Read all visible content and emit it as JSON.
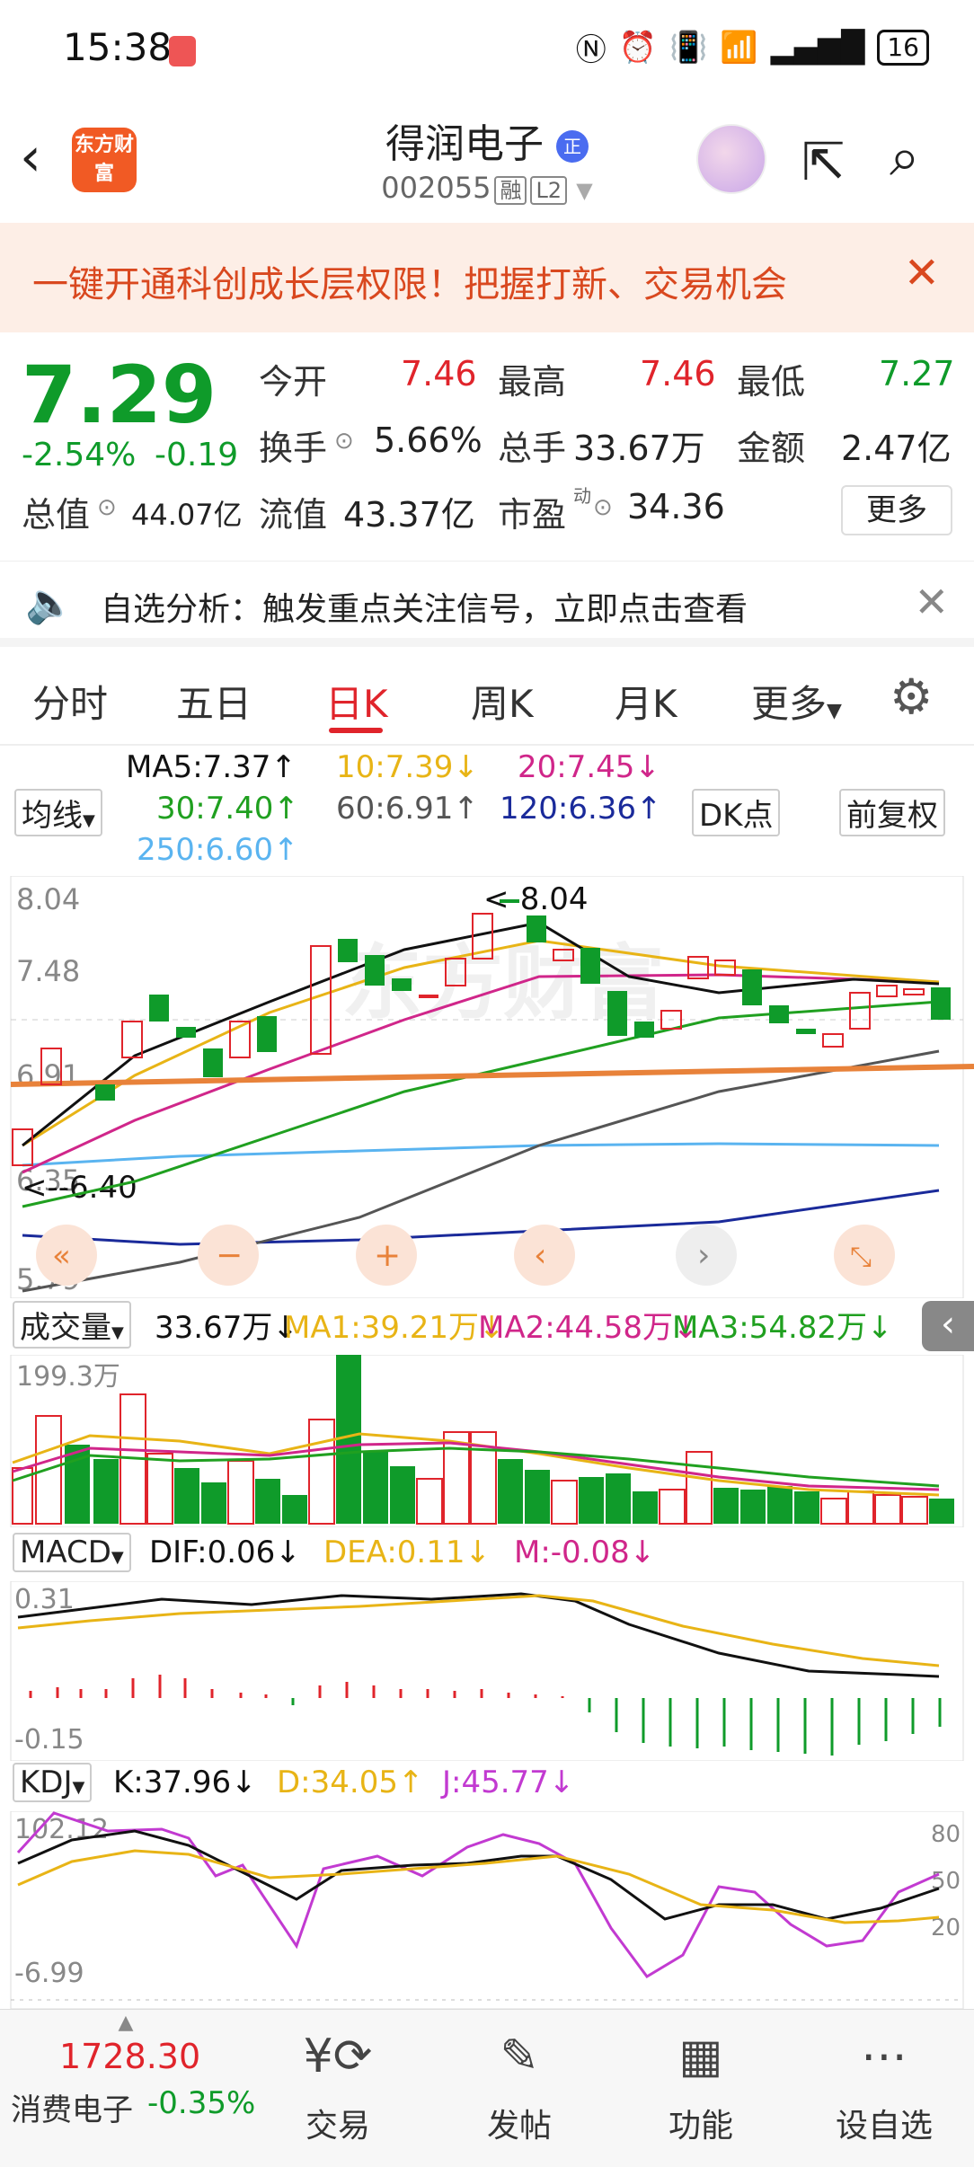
{
  "status": {
    "time": "15:38",
    "battery": "16",
    "signal": "5G"
  },
  "header": {
    "logo_text": "东方财富",
    "stock_name": "得润电子",
    "stock_tag": "正",
    "stock_code": "002055",
    "badge_margin": "融",
    "badge_level": "L2"
  },
  "banner": {
    "text": "一键开通科创成长层权限！把握打新、交易机会"
  },
  "quote": {
    "price": "7.29",
    "change_pct": "-2.54%",
    "change": "-0.19",
    "open_label": "今开",
    "open": "7.46",
    "high_label": "最高",
    "high": "7.46",
    "low_label": "最低",
    "low": "7.27",
    "turnover_label": "换手",
    "turnover": "5.66%",
    "volume_label": "总手",
    "volume": "33.67万",
    "amount_label": "金额",
    "amount": "2.47亿",
    "mktcap_label": "总值",
    "mktcap": "44.07亿",
    "float_label": "流值",
    "float": "43.37亿",
    "pe_label": "市盈",
    "pe_sup": "动",
    "pe": "34.36",
    "more": "更多"
  },
  "notice": {
    "text": "自选分析：触发重点关注信号，立即点击查看"
  },
  "tabs": [
    "分时",
    "五日",
    "日K",
    "周K",
    "月K",
    "更多"
  ],
  "ma_row": {
    "selector": "均线",
    "ma5": "MA5:7.37↑",
    "ma10": "10:7.39↓",
    "ma20": "20:7.45↓",
    "ma30": "30:7.40↑",
    "ma60": "60:6.91↑",
    "ma120": "120:6.36↑",
    "ma250": "250:6.60↑",
    "dk": "DK点",
    "fq": "前复权"
  },
  "kline": {
    "y_top": "8.04",
    "y_mid": "7.48",
    "y_low1": "6.91",
    "y_low2": "6.35",
    "y_bottom": "5.79",
    "max_label": "<-8.04",
    "min_label": "<--6.40",
    "watermark": "东方财富"
  },
  "volume": {
    "selector": "成交量",
    "vol": "33.67万↓",
    "ma1": "MA1:39.21万↓",
    "ma2": "MA2:44.58万↓",
    "ma3": "MA3:54.82万↓",
    "y_top": "199.3万"
  },
  "macd": {
    "selector": "MACD",
    "dif": "DIF:0.06↓",
    "dea": "DEA:0.11↓",
    "m": "M:-0.08↓",
    "y_top": "0.31",
    "y_bottom": "-0.15"
  },
  "kdj": {
    "selector": "KDJ",
    "k": "K:37.96↓",
    "d": "D:34.05↑",
    "j": "J:45.77↓",
    "y_top": "102.12",
    "y_bottom": "-6.99",
    "r80": "80",
    "r50": "50",
    "r20": "20"
  },
  "bottom": {
    "index_value": "1728.30",
    "index_name": "消费电子",
    "index_change": "-0.35%",
    "items": [
      "交易",
      "发帖",
      "功能",
      "设自选"
    ]
  },
  "colors": {
    "up": "#e0242b",
    "down": "#0f9b2a",
    "ma5": "#111111",
    "ma10": "#e8b416",
    "ma20": "#d0268a",
    "ma30": "#20a020",
    "ma60": "#555555",
    "ma120": "#1a2a9a",
    "ma250": "#5ab4f0"
  }
}
